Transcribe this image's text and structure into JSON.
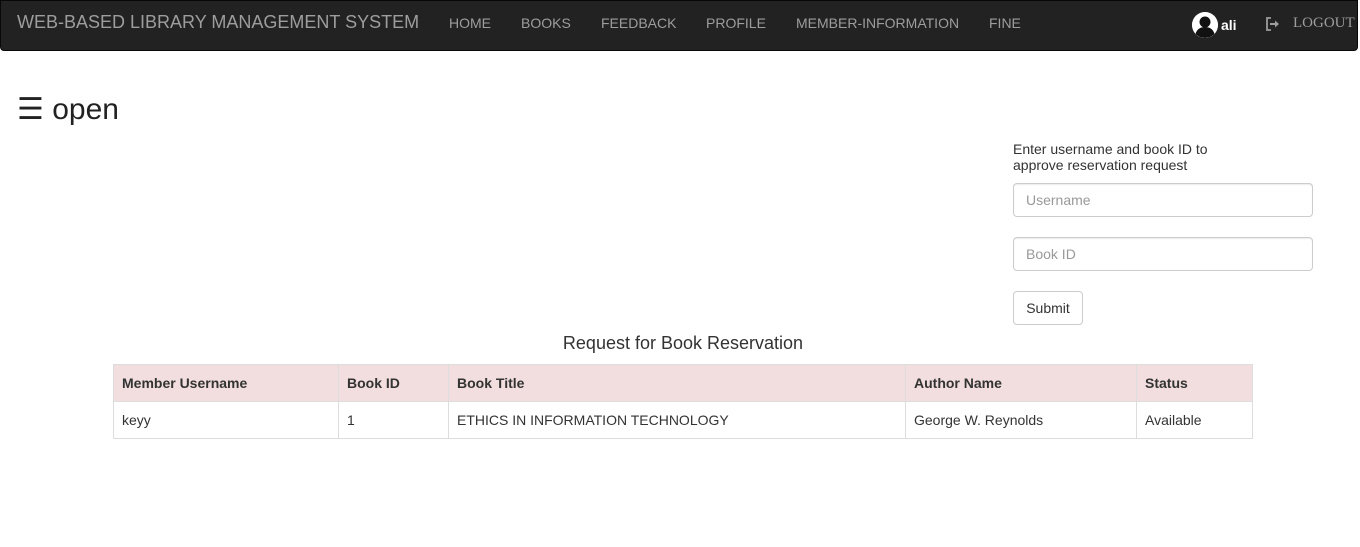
{
  "navbar": {
    "brand": "WEB-BASED LIBRARY MANAGEMENT SYSTEM",
    "links": [
      "HOME",
      "BOOKS",
      "FEEDBACK",
      "PROFILE",
      "MEMBER-INFORMATION",
      "FINE"
    ],
    "user_name": "ali",
    "user_icon": "user-avatar-icon",
    "logout_icon": "logout-icon",
    "logout_label": "LOGOUT"
  },
  "sidebar_toggle": {
    "label": "☰ open"
  },
  "approve_form": {
    "instructions": "Enter username and book ID to approve reservation request",
    "username_placeholder": "Username",
    "bookid_placeholder": "Book ID",
    "submit_label": "Submit"
  },
  "reservations": {
    "title": "Request for Book Reservation",
    "header_color": "#f2dede",
    "columns": [
      "Member Username",
      "Book ID",
      "Book Title",
      "Author Name",
      "Status"
    ],
    "rows": [
      [
        "keyy",
        "1",
        "ETHICS IN INFORMATION TECHNOLOGY",
        "George W. Reynolds",
        "Available"
      ]
    ]
  }
}
